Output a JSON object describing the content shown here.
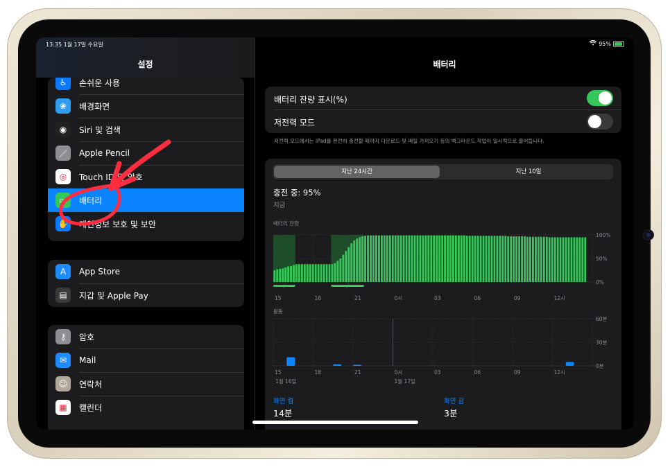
{
  "status": {
    "time_date": "13:35  1월 17일 수요일",
    "battery": "95%"
  },
  "sidebar": {
    "title": "설정",
    "group1": [
      {
        "label": "손쉬운 사용",
        "icon": "accessibility-icon",
        "color": "#0a7aff"
      },
      {
        "label": "배경화면",
        "icon": "wallpaper-icon",
        "color": "#2e9cf0"
      },
      {
        "label": "Siri 및 검색",
        "icon": "siri-icon",
        "color": "#222"
      },
      {
        "label": "Apple Pencil",
        "icon": "pencil-icon",
        "color": "#8e8e93"
      },
      {
        "label": "Touch ID 및 암호",
        "icon": "fingerprint-icon",
        "color": "#ffffff"
      },
      {
        "label": "배터리",
        "icon": "battery-icon",
        "color": "#34c759",
        "selected": true
      },
      {
        "label": "개인정보 보호 및 보안",
        "icon": "hand-icon",
        "color": "#0a7aff"
      }
    ],
    "group2": [
      {
        "label": "App Store",
        "icon": "appstore-icon",
        "color": "#1c8cff"
      },
      {
        "label": "지갑 및 Apple Pay",
        "icon": "wallet-icon",
        "color": "#3a3a3c"
      }
    ],
    "group3": [
      {
        "label": "암호",
        "icon": "key-icon",
        "color": "#8e8e93"
      },
      {
        "label": "Mail",
        "icon": "mail-icon",
        "color": "#1c8cff"
      },
      {
        "label": "연락처",
        "icon": "contacts-icon",
        "color": "#b0a99a"
      },
      {
        "label": "캘린더",
        "icon": "calendar-icon",
        "color": "#ffffff"
      }
    ]
  },
  "main": {
    "title": "배터리",
    "battery_percentage_label": "배터리 잔량 표시(%)",
    "battery_percentage_on": true,
    "low_power_label": "저전력 모드",
    "low_power_on": false,
    "low_power_note": "저전력 모드에서는 iPad를 완전히 충전할 때까지 다운로드 및 메일 가져오기 등의 백그라운드 작업이 일시적으로 줄어듭니다.",
    "tabs": [
      "지난 24시간",
      "지난 10일"
    ],
    "selected_tab": 0,
    "charging_status": "충전 중: 95%",
    "charging_time": "지금",
    "screen_on_label": "화면 켬",
    "screen_on_value": "14분",
    "screen_off_label": "화면 끔",
    "screen_off_value": "3분"
  },
  "chart_data": [
    {
      "type": "bar",
      "title": "배터리 잔량",
      "y_tick_labels": [
        "100%",
        "50%",
        "0%"
      ],
      "ylim": [
        0,
        100
      ],
      "x_tick_labels": [
        "15",
        "18",
        "21",
        "0시",
        "03",
        "06",
        "09",
        "12시"
      ],
      "values": [
        25,
        27,
        28,
        29,
        31,
        33,
        34,
        36,
        38,
        38,
        38,
        38,
        38,
        38,
        38,
        38,
        38,
        38,
        38,
        38,
        38,
        38,
        40,
        45,
        50,
        58,
        66,
        74,
        82,
        88,
        92,
        95,
        97,
        98,
        99,
        99,
        99,
        99,
        99,
        99,
        99,
        99,
        99,
        99,
        99,
        99,
        99,
        99,
        99,
        99,
        99,
        99,
        99,
        99,
        99,
        99,
        99,
        99,
        99,
        99,
        99,
        99,
        99,
        99,
        99,
        99,
        99,
        99,
        99,
        99,
        98,
        98,
        98,
        98,
        98,
        98,
        98,
        98,
        98,
        98,
        98,
        98,
        98,
        98,
        98,
        97,
        97,
        97,
        97,
        97,
        97,
        97,
        96,
        96,
        96,
        96,
        96,
        96,
        96,
        96,
        95,
        95,
        95,
        95,
        95,
        95,
        95,
        95,
        95,
        95,
        95,
        95,
        95,
        95
      ],
      "charging_periods": [
        [
          0,
          8
        ],
        [
          21,
          33
        ]
      ]
    },
    {
      "type": "bar",
      "title": "활동",
      "y_tick_labels": [
        "60분",
        "30분",
        "0분"
      ],
      "ylim": [
        0,
        60
      ],
      "x_tick_labels": [
        "15",
        "18",
        "21",
        "0시",
        "03",
        "06",
        "09",
        "12시"
      ],
      "date_labels": [
        "1월 16일",
        "1월 17일"
      ],
      "bars": [
        {
          "x": "16:00",
          "minutes": 11
        },
        {
          "x": "19:30",
          "minutes": 2
        },
        {
          "x": "21:00",
          "minutes": 1
        },
        {
          "x": "13:00",
          "minutes": 5
        }
      ]
    }
  ],
  "colors": {
    "accent": "#0a84ff",
    "green": "#34c759",
    "annotation": "#ff2d3f"
  }
}
